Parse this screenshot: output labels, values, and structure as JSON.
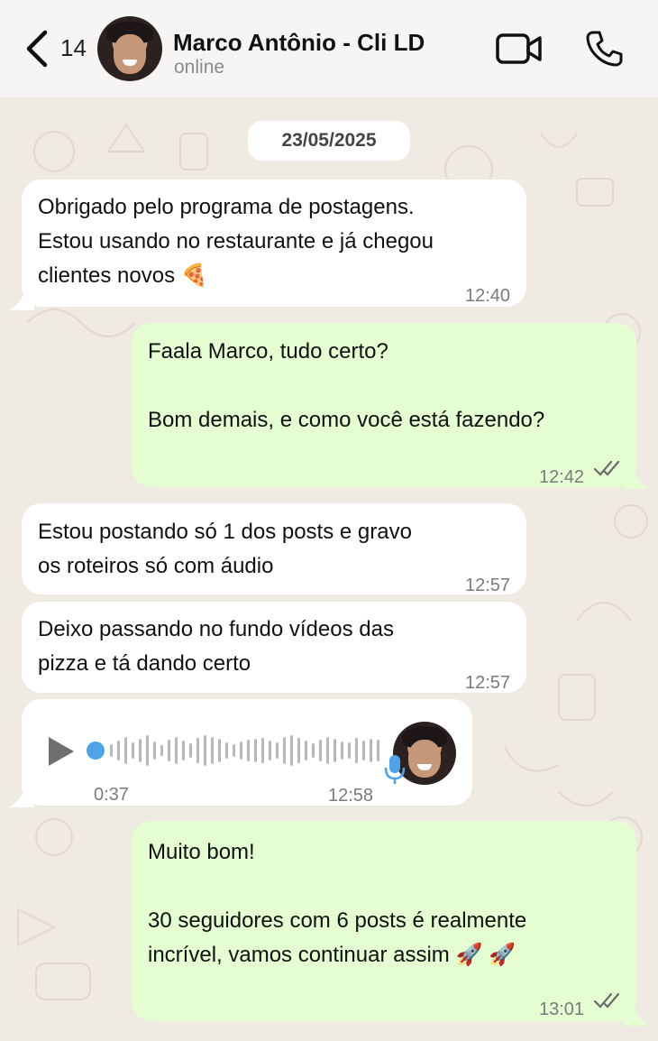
{
  "header": {
    "back_count": "14",
    "contact_name": "Marco Antônio - Cli LD",
    "status": "online",
    "icons": [
      "chevron-left-icon",
      "video-camera-icon",
      "phone-icon"
    ]
  },
  "chat": {
    "date": "23/05/2025",
    "messages": [
      {
        "direction": "incoming",
        "text": "Obrigado pelo programa de postagens.\nEstou usando no restaurante e já chegou\nclientes novos 🍕",
        "time": "12:40"
      },
      {
        "direction": "outgoing",
        "text": "Faala Marco, tudo certo?\n\nBom demais, e como você está fazendo?",
        "time": "12:42",
        "read": true
      },
      {
        "direction": "incoming",
        "text": "Estou postando só 1 dos posts e gravo\nos roteiros só com áudio",
        "time": "12:57"
      },
      {
        "direction": "incoming",
        "text": "Deixo passando no fundo vídeos das\npizza e tá dando certo",
        "time": "12:57"
      },
      {
        "direction": "incoming",
        "type": "voice",
        "duration": "0:37",
        "time": "12:58",
        "progress": 0
      },
      {
        "direction": "outgoing",
        "text": "Muito bom!\n\n30 seguidores com 6 posts é realmente\nincrível, vamos continuar assim 🚀 🚀",
        "time": "13:01",
        "read": true
      }
    ]
  },
  "colors": {
    "incoming_bubble": "#ffffff",
    "outgoing_bubble": "#e4fdd1",
    "wallpaper": "#efeae2",
    "header_bg": "#f6f5f3",
    "read_ticks": "#6b6b6b",
    "voice_dot": "#4fa3e8"
  }
}
